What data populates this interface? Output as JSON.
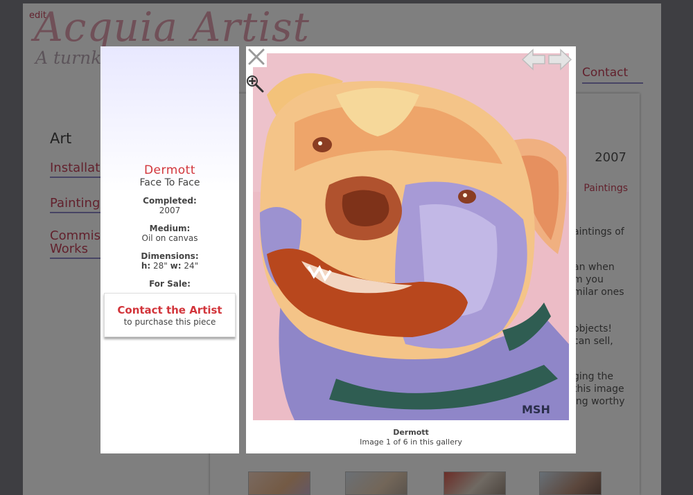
{
  "page": {
    "edit_label": "edit",
    "site_title": "Acquia Artist",
    "tagline": "A turnk",
    "nav_contact": "Contact",
    "sidebar": {
      "heading": "Art",
      "items": [
        {
          "label": "Installat"
        },
        {
          "label": "Painting"
        },
        {
          "label": "Commis\nWorks"
        }
      ]
    },
    "content": {
      "year": "2007",
      "category": "Paintings",
      "snippets": [
        "aintings of",
        "an when\nm you\nmilar ones",
        "objects!\ncan sell,",
        "ging the\nthis image\ning worthy"
      ]
    }
  },
  "lightbox": {
    "info": {
      "title": "Dermott",
      "subtitle": "Face To Face",
      "completed_label": "Completed:",
      "completed_value": "2007",
      "medium_label": "Medium:",
      "medium_value": "Oil on canvas",
      "dimensions_label": "Dimensions:",
      "dim_h_label": "h:",
      "dim_h_value": "28\"",
      "dim_w_label": "w:",
      "dim_w_value": "24\"",
      "for_sale_label": "For Sale:",
      "contact_title": "Contact the Artist",
      "contact_sub": "to purchase this piece"
    },
    "image": {
      "caption_title": "Dermott",
      "caption_count": "Image 1 of 6 in this gallery",
      "signature": "MSH"
    }
  },
  "colors": {
    "accent_red": "#d2353b",
    "link_red": "#c4435a",
    "underline_purple": "#8e89c8",
    "painting_background": "#ecbcc6"
  },
  "icons": [
    "close-icon",
    "zoom-in-icon",
    "arrow-left-icon",
    "arrow-right-icon"
  ]
}
